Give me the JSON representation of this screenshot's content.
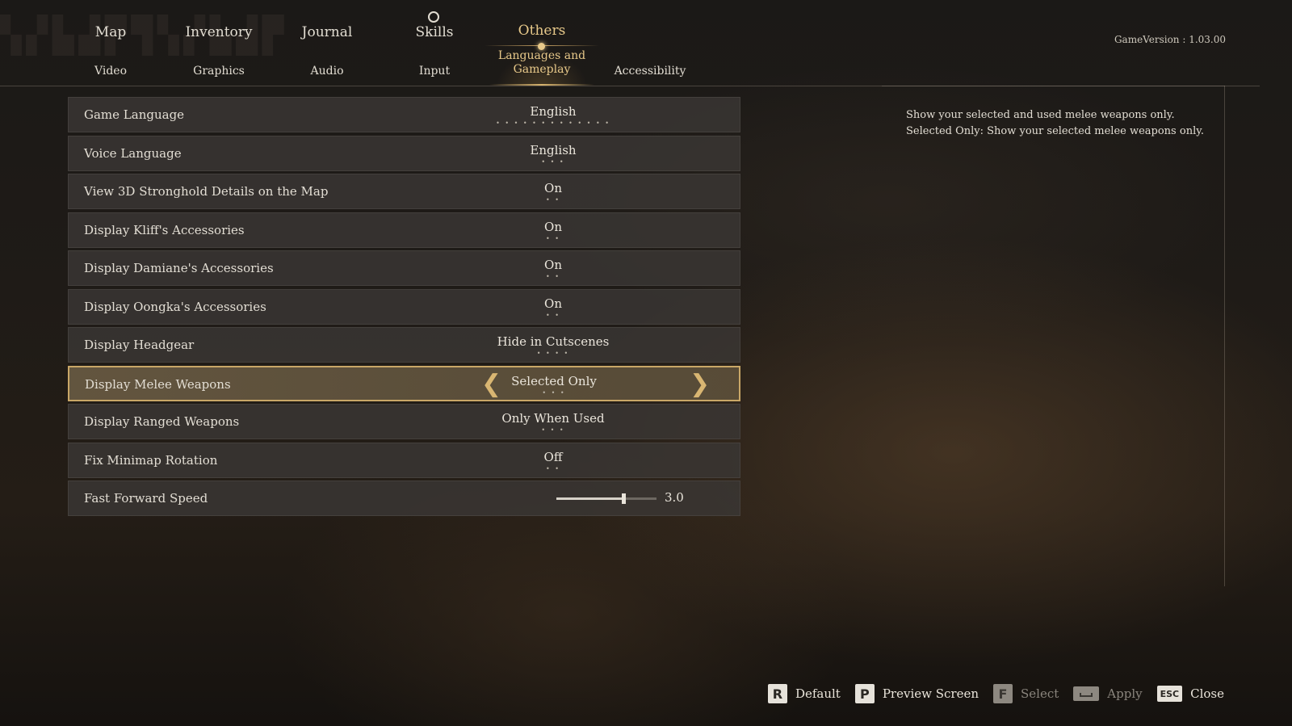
{
  "main_tabs": [
    {
      "label": "Map"
    },
    {
      "label": "Inventory"
    },
    {
      "label": "Journal"
    },
    {
      "label": "Skills"
    },
    {
      "label": "Others"
    }
  ],
  "sub_tabs": [
    {
      "label": "Video"
    },
    {
      "label": "Graphics"
    },
    {
      "label": "Audio"
    },
    {
      "label": "Input"
    },
    {
      "label": "Languages and Gameplay"
    },
    {
      "label": "Accessibility"
    }
  ],
  "version": "GameVersion : 1.03.00",
  "settings": [
    {
      "label": "Game Language",
      "value": "English",
      "dots": "• • • • • • • • • • • • •"
    },
    {
      "label": "Voice Language",
      "value": "English",
      "dots": "• • •"
    },
    {
      "label": "View 3D Stronghold Details on the Map",
      "value": "On",
      "dots": "• •"
    },
    {
      "label": "Display Kliff's Accessories",
      "value": "On",
      "dots": "• •"
    },
    {
      "label": "Display Damiane's Accessories",
      "value": "On",
      "dots": "• •"
    },
    {
      "label": "Display Oongka's Accessories",
      "value": "On",
      "dots": "• •"
    },
    {
      "label": "Display Headgear",
      "value": "Hide in Cutscenes",
      "dots": "• • • •"
    },
    {
      "label": "Display Melee Weapons",
      "value": "Selected Only",
      "dots": "• • •"
    },
    {
      "label": "Display Ranged Weapons",
      "value": "Only When Used",
      "dots": "• • •"
    },
    {
      "label": "Fix Minimap Rotation",
      "value": "Off",
      "dots": "• •"
    },
    {
      "label": "Fast Forward Speed",
      "value": "3.0",
      "slider_fraction": 0.67
    }
  ],
  "description": {
    "line1": "Show your selected and used melee weapons only.",
    "line2": "Selected Only: Show your selected melee weapons only."
  },
  "actions": {
    "default": {
      "key": "R",
      "label": "Default"
    },
    "preview": {
      "key": "P",
      "label": "Preview Screen"
    },
    "select": {
      "key": "F",
      "label": "Select"
    },
    "apply": {
      "key": "",
      "label": "Apply"
    },
    "close": {
      "key": "ESC",
      "label": "Close"
    }
  }
}
